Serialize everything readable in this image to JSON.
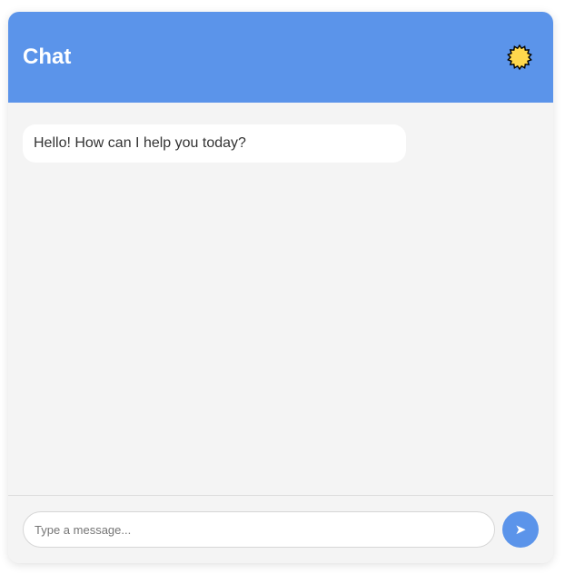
{
  "header": {
    "title": "Chat",
    "theme_icon": "sun-icon"
  },
  "messages": [
    {
      "sender": "bot",
      "text": "Hello! How can I help you today?"
    }
  ],
  "composer": {
    "input_value": "",
    "input_placeholder": "Type a message...",
    "send_icon": "send-arrow-icon",
    "send_glyph": "➤"
  },
  "colors": {
    "accent": "#5b94ea",
    "background": "#f4f4f4",
    "bubble": "#ffffff",
    "sun_fill": "#ffd84d"
  }
}
